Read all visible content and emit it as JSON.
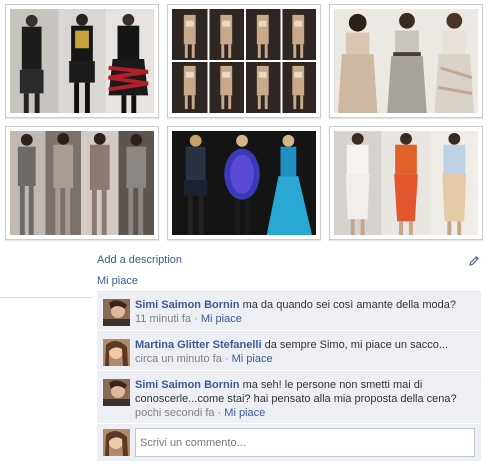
{
  "photos": [
    {
      "label": "runway-look-black-red-ruffles",
      "accent": "#b11e2c"
    },
    {
      "label": "runway-looks-beige-grid",
      "accent": "#c9a98a"
    },
    {
      "label": "runway-looks-pastel-dresses",
      "accent": "#bfa98f"
    },
    {
      "label": "runway-looks-grey-knitwear",
      "accent": "#6e6a68"
    },
    {
      "label": "runway-looks-blue-fur-dresses",
      "accent": "#2aa8d4"
    },
    {
      "label": "runway-looks-orange-white",
      "accent": "#e0622a"
    }
  ],
  "actions": {
    "add_description": "Add a description",
    "like": "Mi piace",
    "edit_icon": "pencil-icon"
  },
  "comments": [
    {
      "author": "Simi Saimon Bornin",
      "text": "ma da quando sei così amante della moda?",
      "time": "11 minuti fa",
      "like": "Mi piace"
    },
    {
      "author": "Martina Glitter Stefanelli",
      "text": "da sempre Simo, mi piace un sacco...",
      "time": "circa un minuto fa",
      "like": "Mi piace"
    },
    {
      "author": "Simi Saimon Bornin",
      "text": "ma seh! le persone non smetti mai di conoscerle...come stai? hai pensato alla mia proposta della cena?",
      "time": "pochi secondi fa",
      "like": "Mi piace"
    }
  ],
  "composer": {
    "placeholder": "Scrivi un commento..."
  },
  "separator": "·",
  "colors": {
    "link": "#3b5998",
    "comment_bg": "#edeff4",
    "meta": "#808080"
  }
}
